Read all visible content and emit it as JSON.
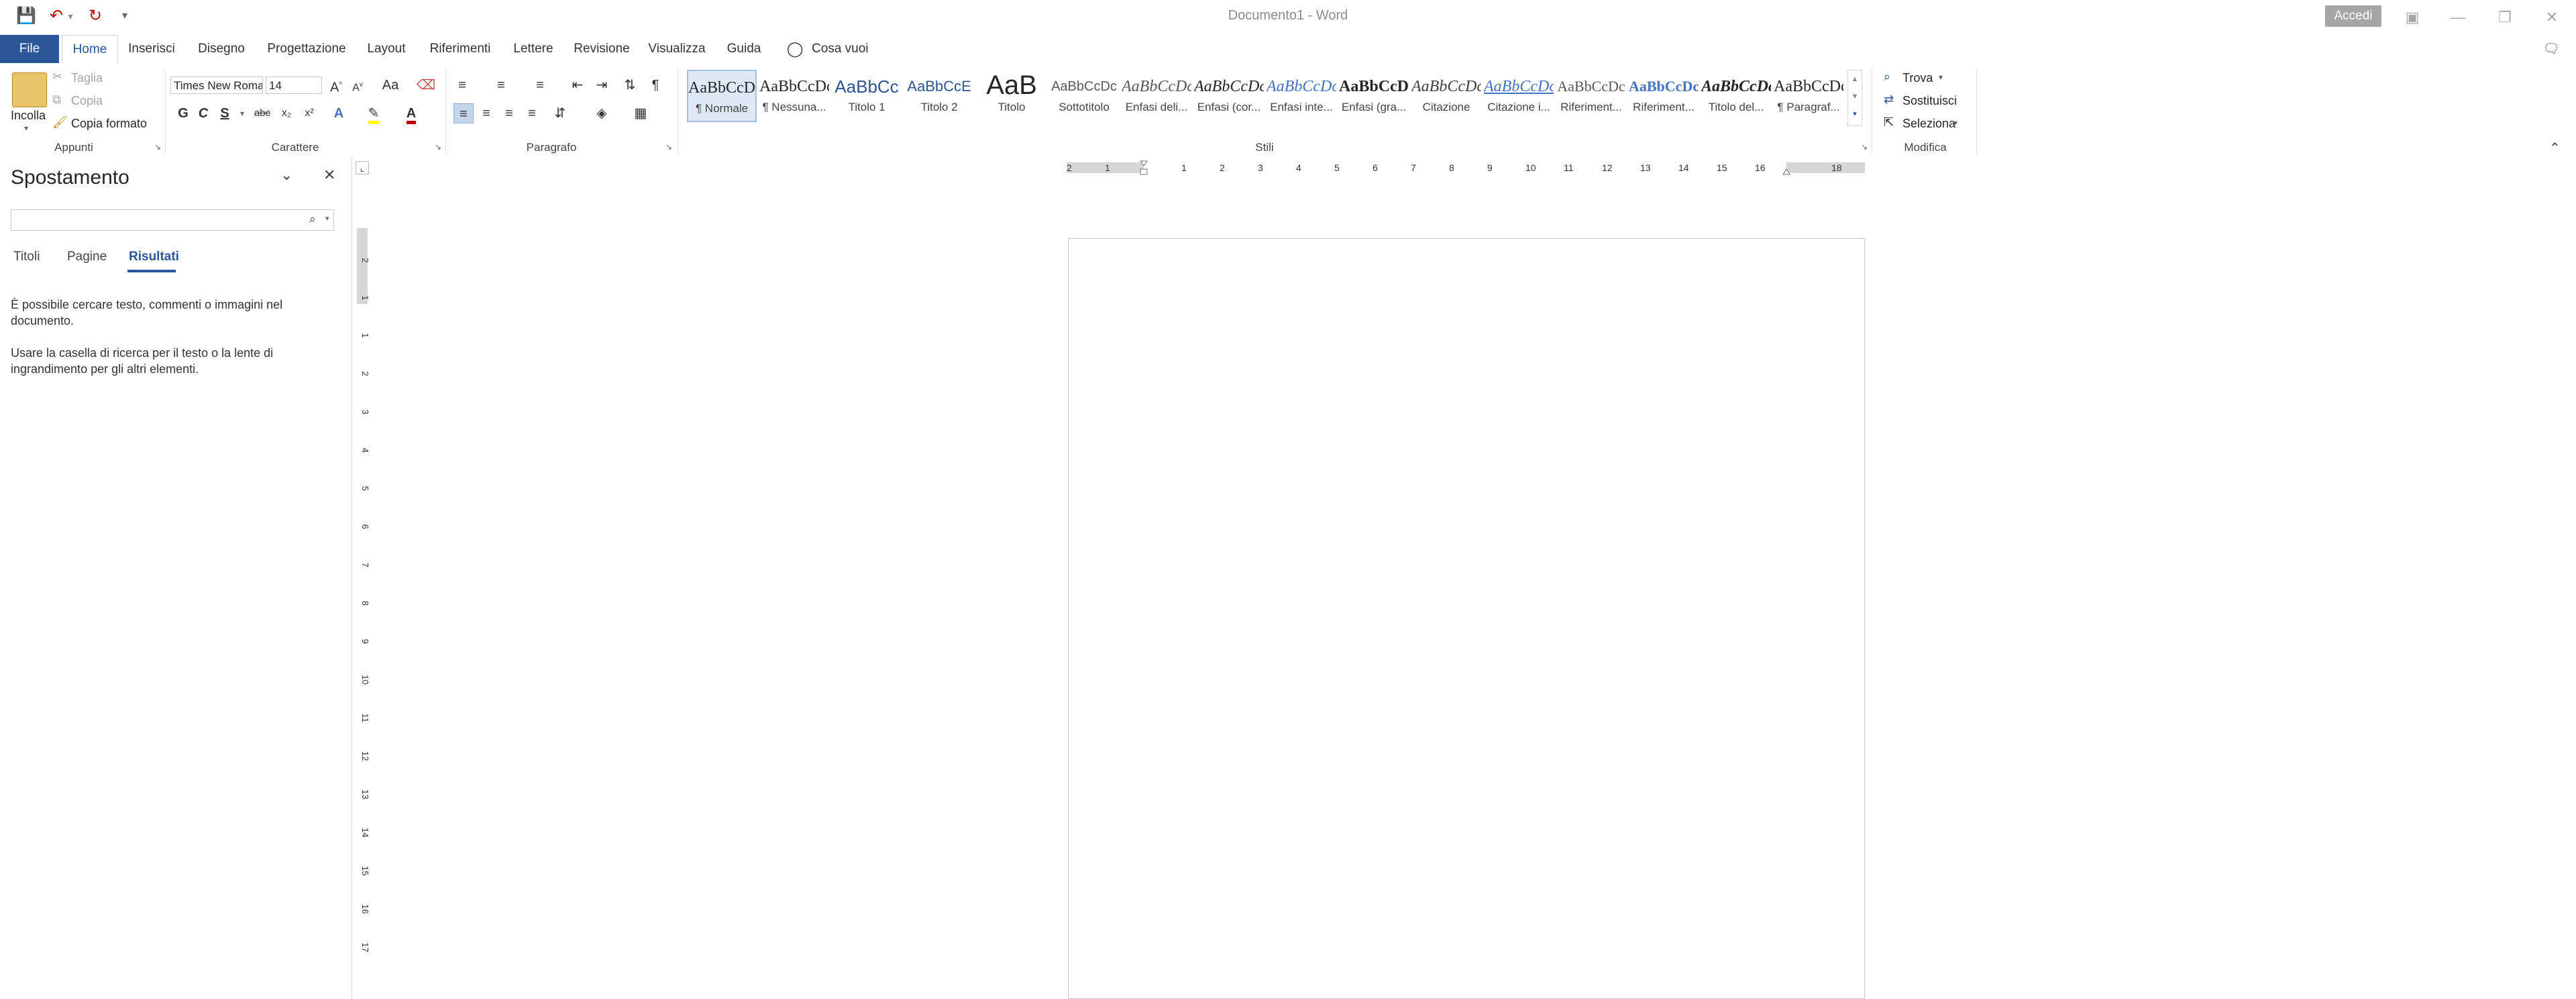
{
  "window": {
    "doc_title": "Documento1  -  Word",
    "signin_label": "Accedi"
  },
  "tabs": {
    "file": "File",
    "home": "Home",
    "insert": "Inserisci",
    "draw": "Disegno",
    "design": "Progettazione",
    "layout": "Layout",
    "references": "Riferimenti",
    "mailings": "Lettere",
    "review": "Revisione",
    "view": "Visualizza",
    "help": "Guida",
    "tell_me": "Cosa vuoi fare?"
  },
  "clipboard": {
    "paste": "Incolla",
    "cut": "Taglia",
    "copy": "Copia",
    "format_painter": "Copia formato",
    "group_label": "Appunti"
  },
  "font": {
    "family": "Times New Roman",
    "size": "14",
    "grow": "A",
    "shrink": "A",
    "change_case": "Aa",
    "bold": "G",
    "italic": "C",
    "underline": "S",
    "strike": "abc",
    "subscript": "x₂",
    "superscript": "x²",
    "group_label": "Carattere"
  },
  "paragraph": {
    "group_label": "Paragrafo"
  },
  "styles": {
    "group_label": "Stili",
    "items": [
      {
        "sample": "AaBbCcDc",
        "name": "¶ Normale"
      },
      {
        "sample": "AaBbCcDc",
        "name": "¶ Nessuna..."
      },
      {
        "sample": "AaBbCc",
        "name": "Titolo 1"
      },
      {
        "sample": "AaBbCcE",
        "name": "Titolo 2"
      },
      {
        "sample": "AaB",
        "name": "Titolo"
      },
      {
        "sample": "AaBbCcDc",
        "name": "Sottotitolo"
      },
      {
        "sample": "AaBbCcDc",
        "name": "Enfasi deli..."
      },
      {
        "sample": "AaBbCcDc",
        "name": "Enfasi (cor..."
      },
      {
        "sample": "AaBbCcDc",
        "name": "Enfasi inte..."
      },
      {
        "sample": "AaBbCcDc",
        "name": "Enfasi (gra..."
      },
      {
        "sample": "AaBbCcDc",
        "name": "Citazione"
      },
      {
        "sample": "AaBbCcDc",
        "name": "Citazione i..."
      },
      {
        "sample": "AaBbCcDc",
        "name": "Riferiment..."
      },
      {
        "sample": "AaBbCcDc",
        "name": "Riferiment..."
      },
      {
        "sample": "AaBbCcDc",
        "name": "Titolo del..."
      },
      {
        "sample": "AaBbCcDc",
        "name": "¶ Paragraf..."
      }
    ]
  },
  "editing": {
    "find": "Trova",
    "replace": "Sostituisci",
    "select": "Seleziona",
    "group_label": "Modifica"
  },
  "nav_pane": {
    "title": "Spostamento",
    "search_placeholder": "",
    "tabs": [
      "Titoli",
      "Pagine",
      "Risultati"
    ],
    "info_1": "È possibile cercare testo, commenti o immagini nel documento.",
    "info_2": "Usare la casella di ricerca per il testo o la lente di ingrandimento per gli altri elementi."
  },
  "ruler": {
    "h_labels": [
      "2",
      "1",
      "1",
      "2",
      "3",
      "4",
      "5",
      "6",
      "7",
      "8",
      "9",
      "10",
      "11",
      "12",
      "13",
      "14",
      "15",
      "16",
      "18"
    ],
    "v_labels": [
      "2",
      "1",
      "1",
      "2",
      "3",
      "4",
      "5",
      "6",
      "7",
      "8",
      "9",
      "10",
      "11",
      "12",
      "13",
      "14",
      "15",
      "16",
      "17"
    ]
  },
  "colors": {
    "accent": "#2b579a",
    "highlight": "#ffff00",
    "font_color": "#c00000",
    "undo_red": "#c00000"
  }
}
